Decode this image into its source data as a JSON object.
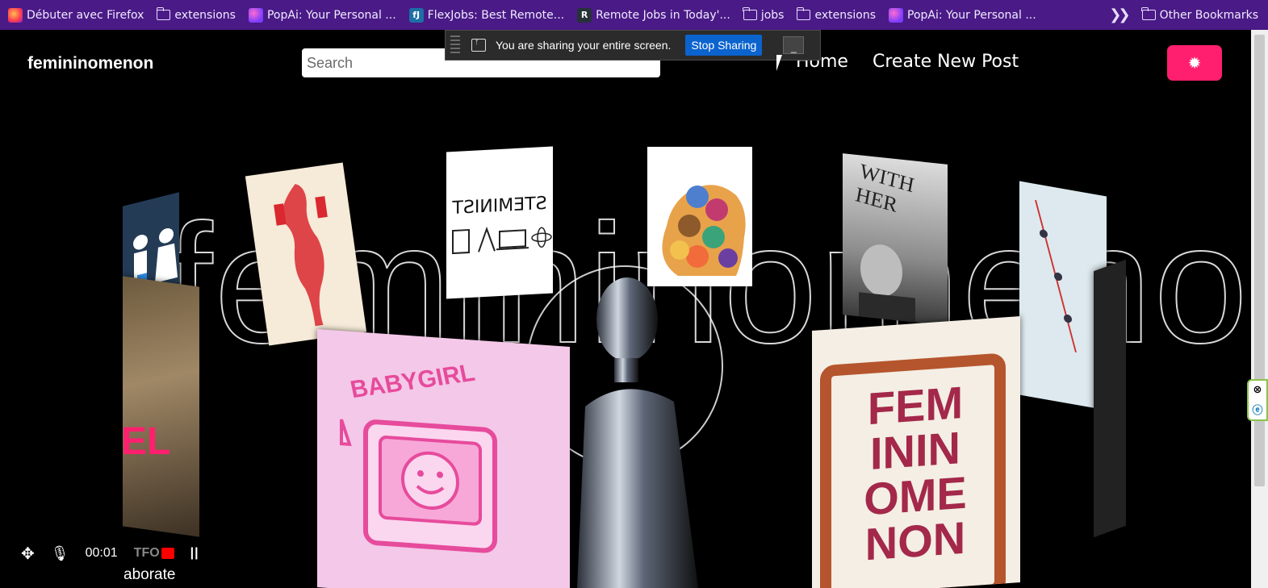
{
  "bookmarks": {
    "items": [
      {
        "label": "Débuter avec Firefox",
        "icon": "firefox-icon"
      },
      {
        "label": "extensions",
        "icon": "folder-icon"
      },
      {
        "label": "PopAi: Your Personal ...",
        "icon": "popai-icon"
      },
      {
        "label": "FlexJobs: Best Remote...",
        "icon": "flexjobs-icon"
      },
      {
        "label": "Remote Jobs in Today'...",
        "icon": "remote-jobs-icon"
      },
      {
        "label": "jobs",
        "icon": "folder-icon"
      },
      {
        "label": "extensions",
        "icon": "folder-icon"
      },
      {
        "label": "PopAi: Your Personal ...",
        "icon": "popai-icon"
      }
    ],
    "other": "Other Bookmarks"
  },
  "share_bar": {
    "message": "You are sharing your entire screen.",
    "stop_label": "Stop Sharing",
    "minimize_label": "_"
  },
  "site": {
    "brand": "femininomenon",
    "search_placeholder": "Search",
    "nav": {
      "home": "Home",
      "create": "Create New Post"
    },
    "theme_icon": "gear-icon"
  },
  "hero": {
    "outline_text": "femininomenon",
    "red_text": "EL",
    "about_text": "aborate"
  },
  "cards": {
    "stemist_text": "STEMINIST",
    "witha_her_text": "WITH HER",
    "fem_text": [
      "FEM",
      "ININ",
      "OME",
      "NON"
    ],
    "baby_text": "BABYGIRL"
  },
  "recorder": {
    "time": "00:01",
    "overlay_text": "TFO"
  },
  "colors": {
    "accent": "#ff1f6e",
    "bookmark_bar": "#4a1a86",
    "share_blue": "#0b63ce"
  }
}
